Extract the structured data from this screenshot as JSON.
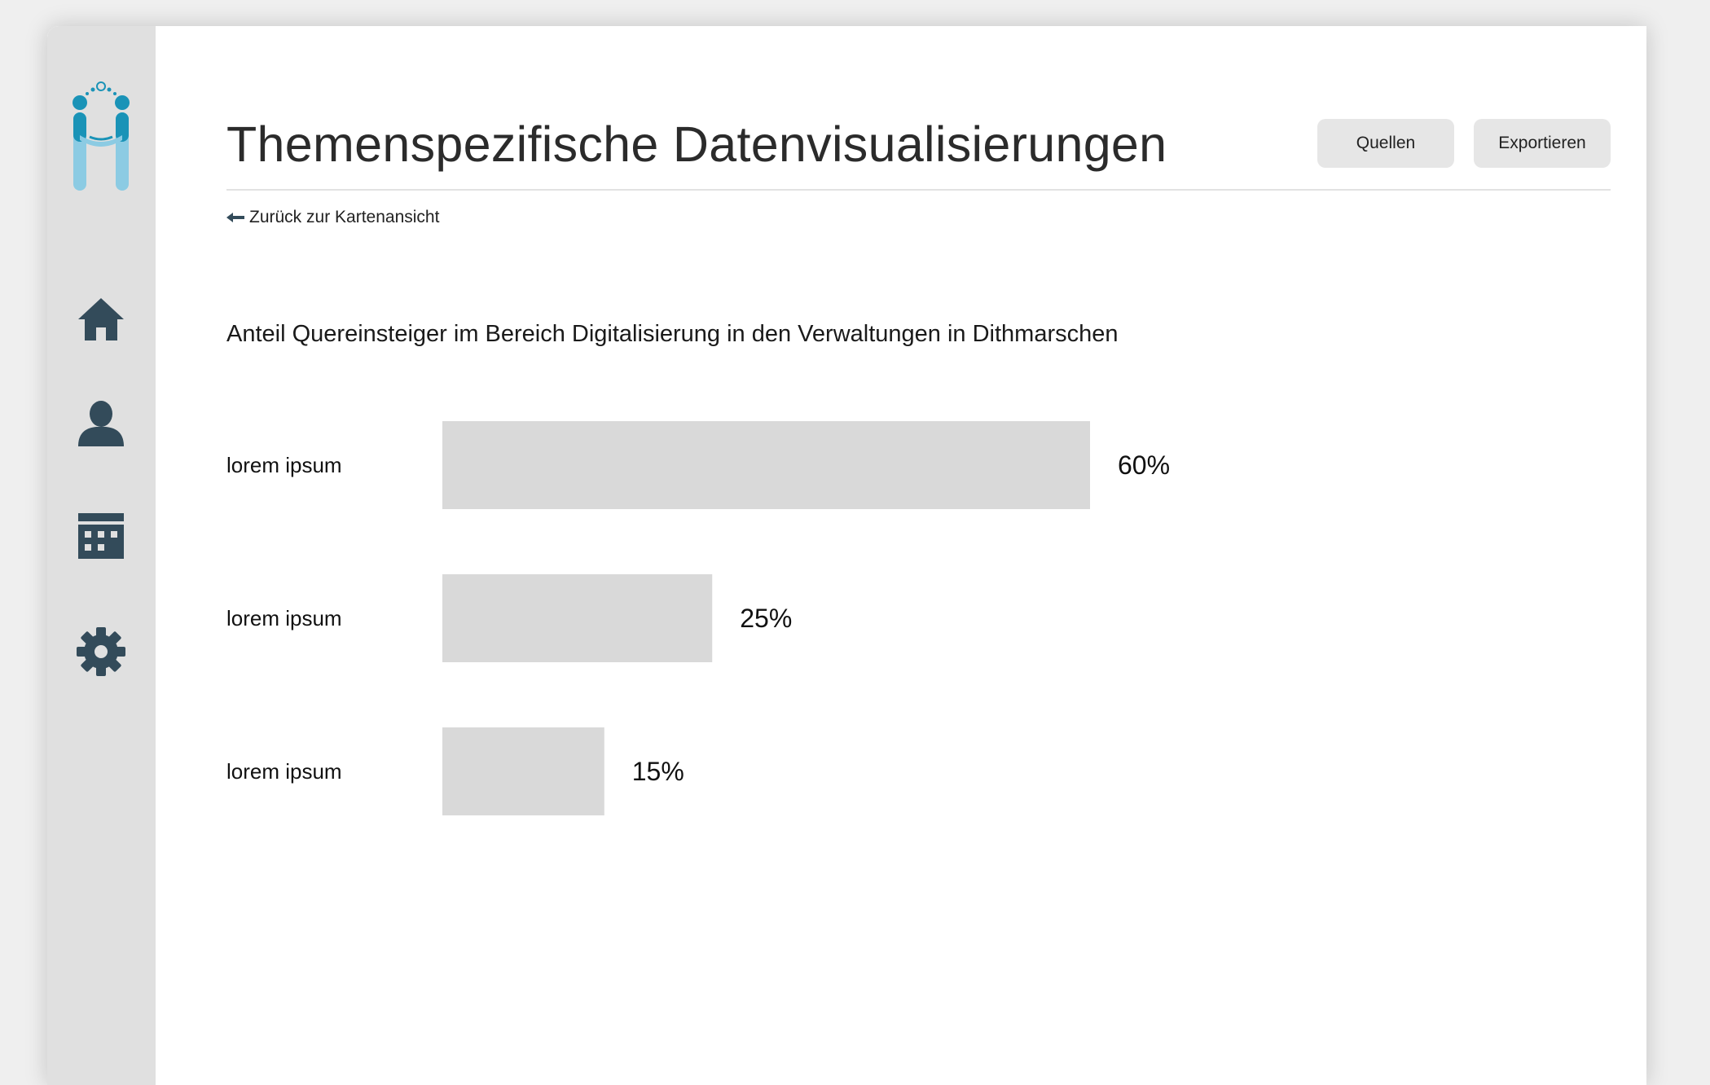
{
  "app": {
    "title": "Themenspezifische Datenvisualisierungen",
    "accent_color": "#1a93b7",
    "logo_light_color": "#8ccbe3"
  },
  "sidebar": {
    "items": [
      {
        "icon": "home-icon"
      },
      {
        "icon": "user-icon"
      },
      {
        "icon": "calendar-icon"
      },
      {
        "icon": "gear-icon"
      }
    ]
  },
  "header": {
    "sources_label": "Quellen",
    "export_label": "Exportieren",
    "back_label": "Zurück zur Kartenansicht"
  },
  "chart_data": {
    "type": "bar",
    "orientation": "horizontal",
    "title": "Anteil Quereinsteiger im Bereich Digitalisierung in den Verwaltungen in Dithmarschen",
    "categories": [
      "lorem ipsum",
      "lorem ipsum",
      "lorem ipsum"
    ],
    "values": [
      60,
      25,
      15
    ],
    "value_labels": [
      "60%",
      "25%",
      "15%"
    ],
    "unit": "%",
    "bar_color": "#d9d9d9",
    "grid": false,
    "legend": "none"
  },
  "footer": {
    "info_icon": "info-icon"
  }
}
